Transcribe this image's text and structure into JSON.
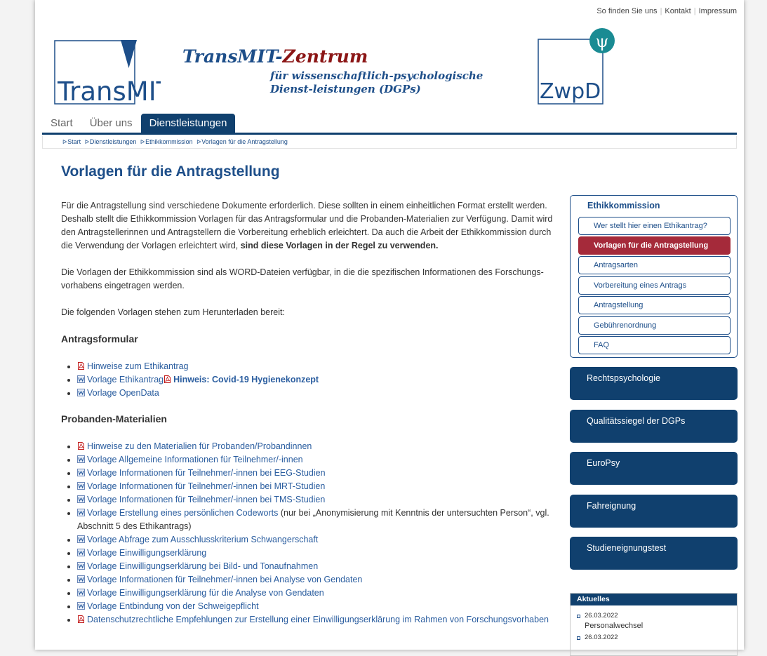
{
  "toplinks": [
    "So finden Sie uns",
    "Kontakt",
    "Impressum"
  ],
  "logo_left_text": "TransMIT",
  "logo_right_text": "ZwpD",
  "logo_right_symbol": "ψ",
  "title": {
    "part1": "TransMIT-",
    "part2": "Zentrum",
    "sub": "für wissenschaftlich-psychologische Dienst-leistungen (DGPs)"
  },
  "nav": [
    {
      "label": "Start"
    },
    {
      "label": "Über uns"
    },
    {
      "label": "Dienstleistungen",
      "active": true
    }
  ],
  "breadcrumb": [
    "Start",
    "Dienstleistungen",
    "Ethikkommission",
    "Vorlagen für die Antragstellung"
  ],
  "page_title": "Vorlagen für die Antragstellung",
  "intro": {
    "p1": "Für die Antragstellung sind verschiedene Dokumente erforderlich. Diese sollten in einem einheitlichen Format erstellt werden. Deshalb stellt die Ethikkommission Vorlagen für das Antragsformular und die Probanden-Materialien zur Verfügung. Damit wird den Antragstellerinnen und Antragstellern die Vorbereitung erheblich erleichtert. Da auch die Arbeit der Ethikkommission durch die Verwendung der Vorlagen erleichtert wird, ",
    "p1_bold": "sind diese Vorlagen in der Regel zu verwenden.",
    "p2": "Die Vorlagen der Ethikkommission sind als WORD-Dateien verfügbar, in die die spezifischen Informationen des Forschungs-vorhabens eingetragen werden.",
    "p3": "Die folgenden Vorlagen stehen zum Herunterladen bereit:"
  },
  "section1": {
    "title": "Antragsformular",
    "items": [
      {
        "text": "Hinweise zum Ethikantrag",
        "icon": "pdf-icon"
      },
      {
        "text": "Vorlage Ethikantrag",
        "icon": "doc-icon",
        "extra": "Hinweis: Covid-19 Hygienekonzept"
      },
      {
        "text": "Vorlage OpenData",
        "icon": "doc-icon"
      }
    ]
  },
  "section2": {
    "title": "Probanden-Materialien",
    "items": [
      {
        "text": "Hinweise zu den Materialien für Probanden/Probandinnen",
        "icon": "pdf-icon"
      },
      {
        "text": "Vorlage Allgemeine Informationen für Teilnehmer/-innen",
        "icon": "doc-icon"
      },
      {
        "text": "Vorlage Informationen für Teilnehmer/-innen bei EEG-Studien",
        "icon": "doc-icon"
      },
      {
        "text": "Vorlage Informationen für Teilnehmer/-innen bei MRT-Studien",
        "icon": "doc-icon"
      },
      {
        "text": "Vorlage Informationen für Teilnehmer/-innen bei TMS-Studien",
        "icon": "doc-icon"
      },
      {
        "text": "Vorlage Erstellung eines persönlichen Codeworts",
        "icon": "doc-icon",
        "note": " (nur bei „Anonymisierung mit Kenntnis der untersuchten Person“, vgl. Abschnitt 5 des Ethikantrags)"
      },
      {
        "text": "Vorlage Abfrage zum Ausschlusskriterium Schwangerschaft",
        "icon": "doc-icon"
      },
      {
        "text": "Vorlage Einwilligungserklärung",
        "icon": "doc-icon"
      },
      {
        "text": "Vorlage Einwilligungserklärung bei Bild- und Tonaufnahmen",
        "icon": "doc-icon"
      },
      {
        "text": "Vorlage Informationen für Teilnehmer/-innen bei Analyse von Gendaten",
        "icon": "doc-icon"
      },
      {
        "text": "Vorlage Einwilligungserklärung für die Analyse von Gendaten",
        "icon": "doc-icon"
      },
      {
        "text": "Vorlage Entbindung von der Schweigepflicht",
        "icon": "doc-icon"
      },
      {
        "text": "Datenschutzrechtliche Empfehlungen zur Erstellung einer Einwilligungserklärung im Rahmen von Forschungsvorhaben",
        "icon": "pdf-icon"
      }
    ]
  },
  "sidebar": {
    "box_title": "Ethikkommission",
    "links": [
      {
        "label": "Wer stellt hier einen Ethikantrag?"
      },
      {
        "label": "Vorlagen für die Antragstellung",
        "active": true
      },
      {
        "label": "Antragsarten"
      },
      {
        "label": "Vorbereitung eines Antrags"
      },
      {
        "label": "Antragstellung"
      },
      {
        "label": "Gebührenordnung"
      },
      {
        "label": "FAQ"
      }
    ],
    "tiles": [
      "Rechtspsychologie",
      "Qualitätssiegel der DGPs",
      "EuroPsy",
      "Fahreignung",
      "Studieneignungstest"
    ]
  },
  "news": {
    "title": "Aktuelles",
    "items": [
      {
        "date": "26.03.2022",
        "title": "Personalwechsel"
      },
      {
        "date": "26.03.2022",
        "title": ""
      }
    ]
  },
  "colors": {
    "primary": "#10406e",
    "accent": "#a52a3a",
    "title_red": "#8b1515",
    "link": "#2a5d9f"
  }
}
